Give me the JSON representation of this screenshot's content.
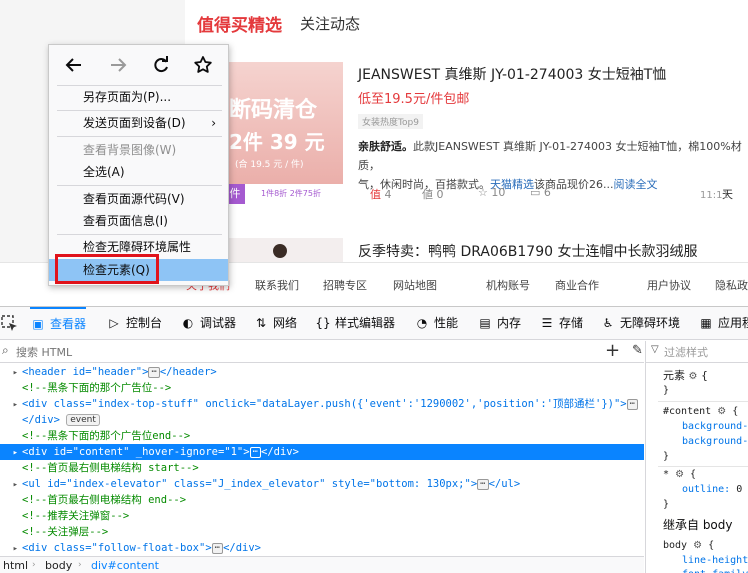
{
  "page": {
    "tabs": [
      "值得买精选",
      "关注动态"
    ],
    "item1": {
      "title": "JEANSWEST 真维斯 JY-01-274003 女士短袖T恤",
      "price": "低至19.5元/件包邮",
      "tag": "女装热度Top9",
      "desc_bold": "亲肤舒适。",
      "desc_text": "此款JEANSWEST 真维斯 JY-01-274003 女士短袖T恤，棉100%材质，",
      "desc_line2_a": "气，休闲时尚，百搭款式。",
      "desc_link1": "天猫精选",
      "desc_line2_b": "该商品现价26...",
      "desc_link2": "阅读全文",
      "like_count": "4",
      "dislike_count": "0",
      "fav_count": "10",
      "comment_count": "6",
      "time": "11:11",
      "store_cut": "天",
      "thumb": {
        "line1": "断码清仓",
        "line2": "2件 39 元",
        "line3": "(合 19.5 元 / 件)",
        "bar_left": "件",
        "bar_right": "1件8折 2件75折"
      }
    },
    "item2": {
      "title": "反季特卖：鸭鸭 DRA06B1790 女士连帽中长款羽绒服"
    },
    "footer_links": [
      "关于我们",
      "联系我们",
      "招聘专区",
      "网站地图",
      "机构账号",
      "商业合作",
      "用户协议",
      "隐私政"
    ]
  },
  "context_menu": {
    "nav": [
      "back-icon",
      "forward-icon",
      "reload-icon",
      "bookmark-star-icon"
    ],
    "items": [
      {
        "label": "另存页面为(P)...",
        "disabled": false
      },
      {
        "label": "发送页面到设备(D)",
        "disabled": false,
        "submenu": "›"
      },
      {
        "label": "查看背景图像(W)",
        "disabled": true
      },
      {
        "label": "全选(A)",
        "disabled": false
      },
      {
        "label": "查看页面源代码(V)",
        "disabled": false
      },
      {
        "label": "查看页面信息(I)",
        "disabled": false
      },
      {
        "label": "检查无障碍环境属性",
        "disabled": false
      },
      {
        "label": "检查元素(Q)",
        "disabled": false,
        "highlighted": true
      }
    ]
  },
  "devtools": {
    "tabs": [
      {
        "icon": "inspector-icon",
        "glyph": "▣",
        "label": "查看器",
        "active": true
      },
      {
        "icon": "console-icon",
        "glyph": "▷",
        "label": "控制台"
      },
      {
        "icon": "debugger-icon",
        "glyph": "◐",
        "label": "调试器"
      },
      {
        "icon": "network-icon",
        "glyph": "⇅",
        "label": "网络"
      },
      {
        "icon": "style-editor-icon",
        "glyph": "{}",
        "label": "样式编辑器"
      },
      {
        "icon": "performance-icon",
        "glyph": "◔",
        "label": "性能"
      },
      {
        "icon": "memory-icon",
        "glyph": "▤",
        "label": "内存"
      },
      {
        "icon": "storage-icon",
        "glyph": "☰",
        "label": "存储"
      },
      {
        "icon": "accessibility-icon",
        "glyph": "♿",
        "label": "无障碍环境"
      },
      {
        "icon": "application-icon",
        "glyph": "▦",
        "label": "应用程"
      }
    ],
    "search_placeholder": "搜索 HTML",
    "filter_placeholder": "过滤样式",
    "markup_lines": [
      "<header id=\"header\">",
      "<!--黑条下面的那个广告位-->",
      "<div class=\"index-top-stuff\" onclick=\"dataLayer.push({'event':'1290002','position':'顶部通栏'})\">",
      "</div>",
      "<!--黑条下面的那个广告位end-->",
      "<div id=\"content\" _hover-ignore=\"1\">",
      "<!--首页最右侧电梯结构 start-->",
      "<ul id=\"index-elevator\" class=\"J_index_elevator\" style=\"bottom: 130px;\">",
      "<!--首页最右侧电梯结构 end-->",
      "<!--推荐关注弹窗-->",
      "<!--关注弹层-->",
      "<div class=\"follow-float-box\">"
    ],
    "event_badge": "event",
    "ellipsis": "⋯",
    "breadcrumbs": [
      "html",
      "body",
      "div#content"
    ],
    "rules": {
      "element_label": "元素",
      "content_selector": "#content",
      "content_props": [
        "background-",
        "background-"
      ],
      "star_selector": "*",
      "star_prop": "outline:",
      "star_val": "0",
      "inherited_label": "继承自 body",
      "body_selector": "body",
      "body_props": [
        "line-height",
        "font-family"
      ]
    }
  }
}
